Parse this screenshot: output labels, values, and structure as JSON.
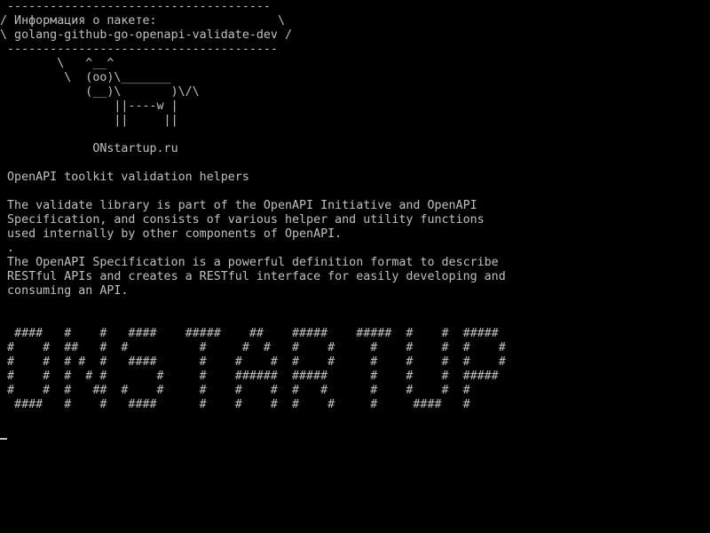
{
  "terminal": {
    "foreground": "#c0c0c0",
    "background": "#000000",
    "lines": [
      " -------------------------------------",
      "/ Информация о пакете:                 \\",
      "\\ golang-github-go-openapi-validate-dev /",
      " --------------------------------------",
      "        \\   ^__^",
      "         \\  (oo)\\_______",
      "            (__)\\       )\\/\\",
      "                ||----w |",
      "                ||     ||",
      "",
      "             ONstartup.ru",
      "",
      " OpenAPI toolkit validation helpers",
      "",
      " The validate library is part of the OpenAPI Initiative and OpenAPI",
      " Specification, and consists of various helper and utility functions",
      " used internally by other components of OpenAPI.",
      " .",
      " The OpenAPI Specification is a powerful definition format to describe",
      " RESTful APIs and creates a RESTful interface for easily developing and",
      " consuming an API.",
      "",
      "",
      "  ####   #    #   ####    #####    ##    #####    #####  #    #  #####",
      " #    #  ##   #  #          #     #  #   #    #     #    #    #  #    #",
      " #    #  # #  #   ####      #    #    #  #    #     #    #    #  #    #",
      " #    #  #  # #       #     #    ######  #####      #    #    #  #####",
      " #    #  #   ##  #    #     #    #    #  #   #      #    #    #  #",
      "  ####   #    #   ####      #    #    #  #    #     #     ####   #",
      "",
      ""
    ]
  }
}
